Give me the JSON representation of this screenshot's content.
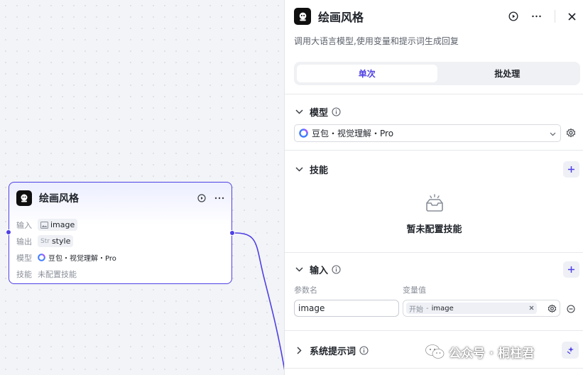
{
  "colors": {
    "accent": "#4e40e5",
    "edge": "#4e40e5",
    "canvas_bg": "#f3f4f7",
    "panel_bg": "#ffffff",
    "muted_text": "#8a8f99"
  },
  "node": {
    "title": "绘画风格",
    "icons": [
      "app-logo-icon",
      "play-icon",
      "more-icon"
    ],
    "rows": {
      "input_label": "输入",
      "input_type": "image-icon",
      "input_value": "image",
      "output_label": "输出",
      "output_type": "Str",
      "output_value": "style",
      "model_label": "模型",
      "model_value": "豆包・视觉理解・Pro",
      "skill_label": "技能",
      "skill_value": "未配置技能"
    }
  },
  "panel": {
    "title": "绘画风格",
    "description": "调用大语言模型,使用变量和提示词生成回复",
    "tabs": [
      {
        "label": "单次",
        "active": true
      },
      {
        "label": "批处理",
        "active": false
      }
    ],
    "model_section": {
      "title": "模型",
      "selected_model": "豆包・视觉理解・Pro"
    },
    "skill_section": {
      "title": "技能",
      "empty_text": "暂未配置技能"
    },
    "input_section": {
      "title": "输入",
      "col_param": "参数名",
      "col_value": "变量值",
      "param_value": "image",
      "var_source": "开始",
      "var_separator": "-",
      "var_value": "image"
    },
    "prompt_section": {
      "title": "系统提示词"
    }
  },
  "watermark": {
    "text": "公众号 · 桐柱君"
  }
}
